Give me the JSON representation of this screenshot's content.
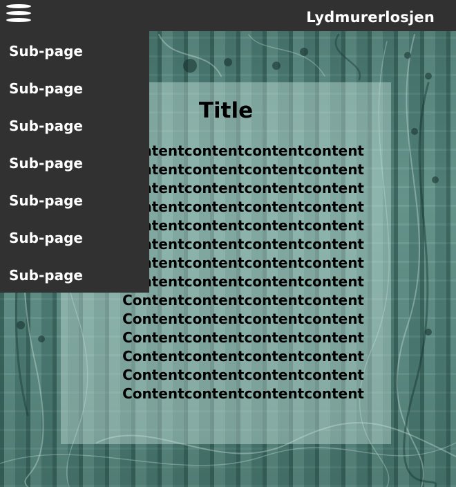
{
  "header": {
    "site_title": "Lydmurerlosjen",
    "menu_icon": "hamburger-menu-icon"
  },
  "nav": {
    "items": [
      {
        "label": "Sub-page"
      },
      {
        "label": "Sub-page"
      },
      {
        "label": "Sub-page"
      },
      {
        "label": "Sub-page"
      },
      {
        "label": "Sub-page"
      },
      {
        "label": "Sub-page"
      },
      {
        "label": "Sub-page"
      }
    ]
  },
  "main": {
    "title": "Title",
    "lines": [
      "Contentcontentcontentcontent",
      "Contentcontentcontentcontent",
      "Contentcontentcontentcontent",
      "Contentcontentcontentcontent",
      "Contentcontentcontentcontent",
      "Contentcontentcontentcontent",
      "Contentcontentcontentcontent",
      "Contentcontentcontentcontent",
      "Contentcontentcontentcontent",
      "Contentcontentcontentcontent",
      "Contentcontentcontentcontent",
      "Contentcontentcontentcontent",
      "Contentcontentcontentcontent",
      "Contentcontentcontentcontent"
    ]
  },
  "colors": {
    "bar": "#313131",
    "text_light": "#ffffff",
    "background_tint": "#5e8f86"
  }
}
